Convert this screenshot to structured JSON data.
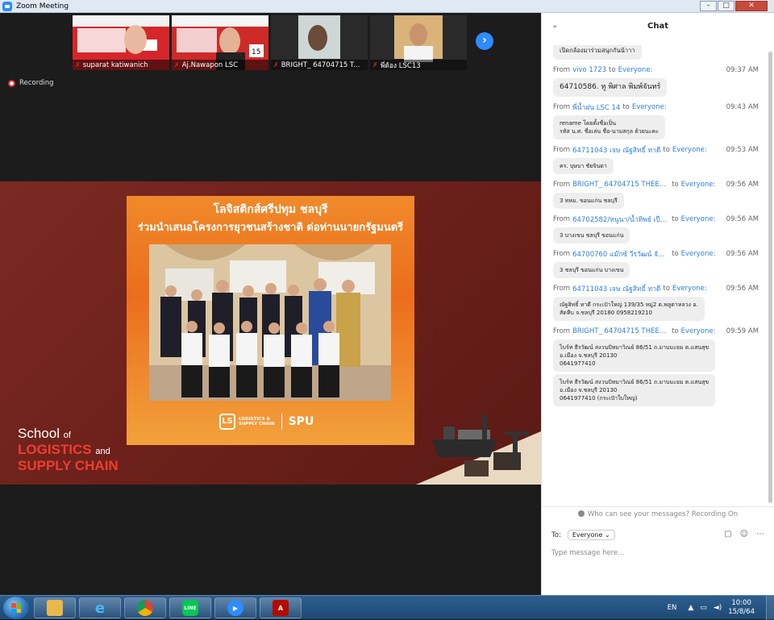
{
  "window": {
    "title": "Zoom Meeting",
    "controls": [
      "–",
      "□",
      "✕"
    ]
  },
  "participants": [
    {
      "name": "suparat katiwanich"
    },
    {
      "name": "Aj.Nawapon LSC"
    },
    {
      "name": "BRIGHT_ 64704715 T..."
    },
    {
      "name": "พี่ต้อง LSC13"
    }
  ],
  "recording_label": "Recording",
  "slide": {
    "headline": "โลจิสติกส์ศรีปทุม ชลบุรี",
    "subheadline": "ร่วมนำเสนอโครงการยุวชนสร้างชาติ ต่อท่านนายกรัฐมนตรี",
    "logo_mark": "LS",
    "logo_text_line1": "LOGISTICS &",
    "logo_text_line2": "SUPPLY CHAIN",
    "spu": "SPU",
    "school_line1": "School",
    "school_of": "of",
    "school_line2": "LOGISTICS",
    "school_and": "and",
    "school_line3": "SUPPLY CHAIN"
  },
  "chat": {
    "title": "Chat",
    "from_word": "From",
    "to_word": "to",
    "messages": [
      {
        "sender": "",
        "recipient": "",
        "time": "",
        "lines": "เปิดกล้องมาร่วมสนุกกันน้าาา",
        "partial": true
      },
      {
        "sender": "vivo 1723",
        "recipient": "Everyone:",
        "time": "09:37 AM",
        "lines": "64710586. ทู พิศาล พิมพ์จันทร์"
      },
      {
        "sender": "พี่น้ำฝน LSC 14",
        "recipient": "Everyone:",
        "time": "09:43 AM",
        "lines": "rename โดยตั้งชื่อเป็น\nรหัส น.ศ. ชื่อเล่น ชื่อ-นามสกุล ด้วยนะคะ"
      },
      {
        "sender": "64711043 เจษ ณัฐสิทธิ์ ทาดี",
        "recipient": "Everyone:",
        "time": "09:53 AM",
        "lines": "คร. บุษบา ชัยจินดา"
      },
      {
        "sender": "BRIGHT_ 64704715 THEER...",
        "recipient": "Everyone:",
        "time": "09:56 AM",
        "lines": "3 ทหม. ขอนแก่น ชลบุรี"
      },
      {
        "sender": "64702582/หนูนา/น้ำทิพย์ เปือก...",
        "recipient": "Everyone:",
        "time": "09:56 AM",
        "lines": "3 บางเขน ชลบุรี ขอนแก่น"
      },
      {
        "sender": "64700760 แม๊กซ์ วีรวัฒน์ จันทร์...",
        "recipient": "Everyone:",
        "time": "09:56 AM",
        "lines": "3 ชลบุรี ขอนแก่น บางเขน"
      },
      {
        "sender": "64711043 เจษ ณัฐสิทธิ์ ทาดี",
        "recipient": "Everyone:",
        "time": "09:56 AM",
        "lines": "ณัฐสิทธิ์ ทาดี กระเป๋าใหญ่ 139/35 หมู่2 ต.พลูตาหลวง อ.\nสัตหีบ จ.ชลบุรี 20180 0958219210"
      },
      {
        "sender": "BRIGHT_ 64704715 THEER...",
        "recipient": "Everyone:",
        "time": "09:59 AM",
        "lines": "ไบร์ท ธีรวัฒน์ สงวนปัทมาวิณย์ 86/51 ถ.มาบมะยม ต.แสนสุข\nอ.เมือง จ.ชลบุรี 20130\n0641977410",
        "extra_bubble": "ไบร์ท ธีรวัฒน์ สงวนปัทมาวิณย์ 86/51 ถ.มาบมะยม ต.แสนสุข\nอ.เมือง จ.ชลบุรี 20130\n0641977410 (กระเป๋าใบใหญ่)"
      }
    ],
    "notice": "Who can see your messages? Recording On",
    "to_label": "To:",
    "to_value": "Everyone",
    "input_placeholder": "Type message here..."
  },
  "taskbar": {
    "apps": [
      "File Explorer",
      "Internet Explorer",
      "Chrome",
      "LINE",
      "Zoom",
      "Acrobat"
    ],
    "lang": "EN",
    "time": "10:00",
    "date": "15/8/64"
  }
}
